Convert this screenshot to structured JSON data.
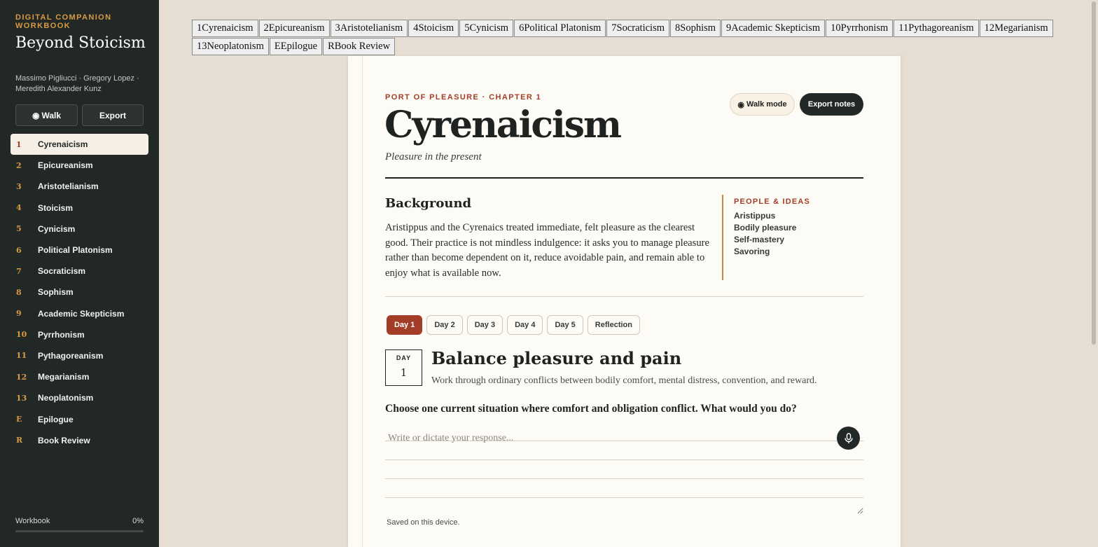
{
  "sidebar": {
    "eyebrow": "Digital Companion Workbook",
    "title": "Beyond Stoicism",
    "authors": "Massimo Pigliucci · Gregory Lopez · Meredith Alexander Kunz",
    "walk_icon": "◉",
    "walk_label": "Walk",
    "export_label": "Export",
    "items": [
      {
        "num": "1",
        "label": "Cyrenaicism"
      },
      {
        "num": "2",
        "label": "Epicureanism"
      },
      {
        "num": "3",
        "label": "Aristotelianism"
      },
      {
        "num": "4",
        "label": "Stoicism"
      },
      {
        "num": "5",
        "label": "Cynicism"
      },
      {
        "num": "6",
        "label": "Political Platonism"
      },
      {
        "num": "7",
        "label": "Socraticism"
      },
      {
        "num": "8",
        "label": "Sophism"
      },
      {
        "num": "9",
        "label": "Academic Skepticism"
      },
      {
        "num": "10",
        "label": "Pyrrhonism"
      },
      {
        "num": "11",
        "label": "Pythagoreanism"
      },
      {
        "num": "12",
        "label": "Megarianism"
      },
      {
        "num": "13",
        "label": "Neoplatonism"
      },
      {
        "num": "E",
        "label": "Epilogue"
      },
      {
        "num": "R",
        "label": "Book Review"
      }
    ],
    "progress_label": "Workbook",
    "progress_value": "0%",
    "progress_fraction": 0
  },
  "chapter_tabs": [
    "1Cyrenaicism",
    "2Epicureanism",
    "3Aristotelianism",
    "4Stoicism",
    "5Cynicism",
    "6Political Platonism",
    "7Socraticism",
    "8Sophism",
    "9Academic Skepticism",
    "10Pyrrhonism",
    "11Pythagoreanism",
    "12Megarianism",
    "13Neoplatonism",
    "EEpilogue",
    "RBook Review"
  ],
  "main": {
    "eyebrow": "PORT OF PLEASURE · CHAPTER 1",
    "title": "Cyrenaicism",
    "subtitle": "Pleasure in the present",
    "walk_icon": "◉",
    "walk_label": "Walk mode",
    "export_label": "Export notes",
    "background_heading": "Background",
    "background_text": "Aristippus and the Cyrenaics treated immediate, felt pleasure as the clearest good. Their practice is not mindless indulgence: it asks you to manage pleasure rather than become dependent on it, reduce avoidable pain, and remain able to enjoy what is available now.",
    "ideas_heading": "PEOPLE & IDEAS",
    "ideas": [
      "Aristippus",
      "Bodily pleasure",
      "Self-mastery",
      "Savoring"
    ],
    "day_tabs": [
      "Day 1",
      "Day 2",
      "Day 3",
      "Day 4",
      "Day 5",
      "Reflection"
    ],
    "day_box_label": "DAY",
    "day_box_num": "1",
    "day_title": "Balance pleasure and pain",
    "day_desc": "Work through ordinary conflicts between bodily comfort, mental distress, convention, and reward.",
    "prompt": "Choose one current situation where comfort and obligation conflict. What would you do?",
    "response_placeholder": "Write or dictate your response...",
    "saved_text": "Saved on this device."
  },
  "colors": {
    "accent": "#a33d28",
    "gold": "#d99a45",
    "sidebar_bg": "#222826",
    "page_bg": "#e6ded2"
  }
}
